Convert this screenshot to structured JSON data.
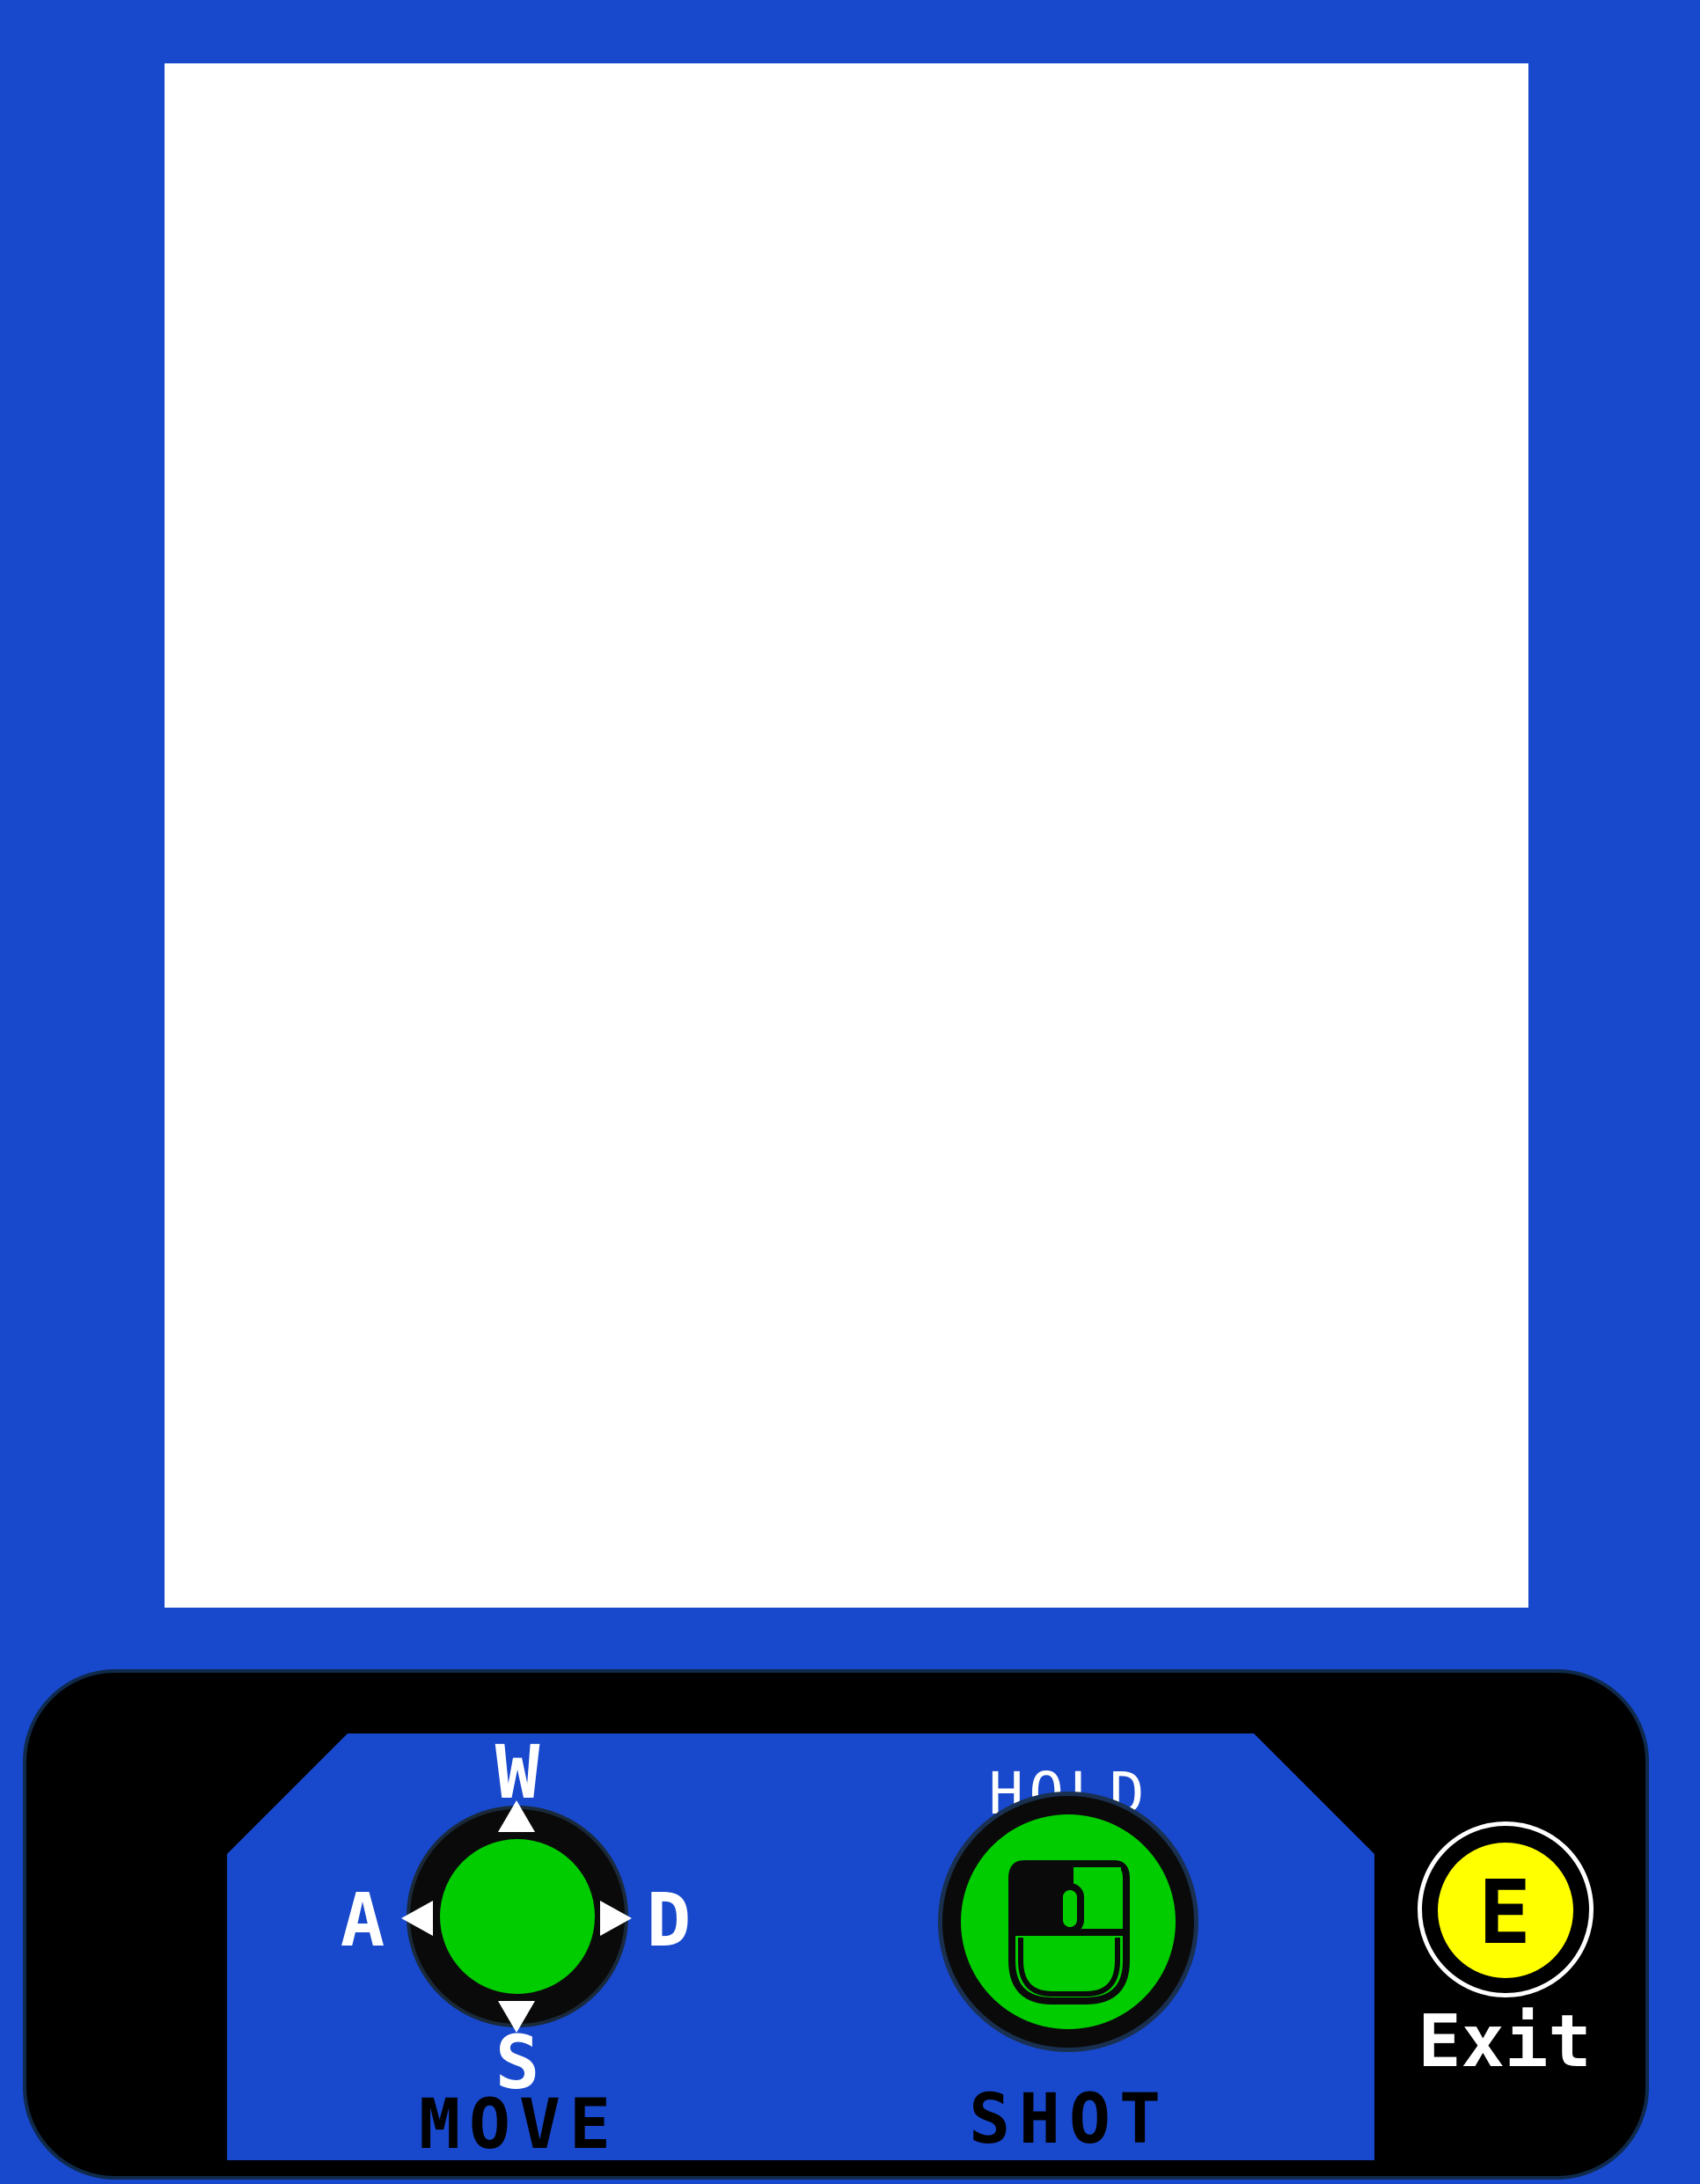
{
  "theme": {
    "background": "#1848cc",
    "screen": "#ffffff",
    "console": "#000000",
    "panel": "#1848cc",
    "button_green": "#00cc00",
    "exit_yellow": "#ffff00"
  },
  "controls": {
    "move": {
      "label": "MOVE",
      "keys": {
        "up": "W",
        "left": "A",
        "down": "S",
        "right": "D"
      },
      "icon": "joystick-icon"
    },
    "shot": {
      "hint": "HOLD",
      "label": "SHOT",
      "icon": "mouse-icon"
    },
    "exit": {
      "key": "E",
      "label": "Exit",
      "icon": "exit-button-icon"
    }
  }
}
